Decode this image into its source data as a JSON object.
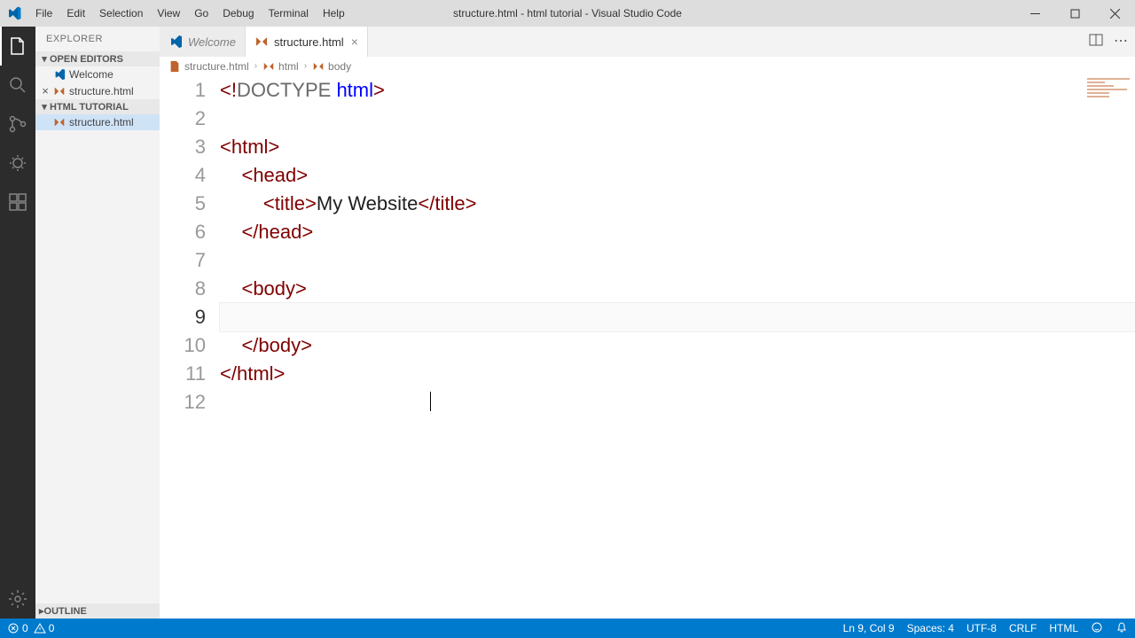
{
  "window": {
    "title": "structure.html - html tutorial - Visual Studio Code"
  },
  "menu": [
    "File",
    "Edit",
    "Selection",
    "View",
    "Go",
    "Debug",
    "Terminal",
    "Help"
  ],
  "sidebar": {
    "title": "Explorer",
    "sections": {
      "open_editors": {
        "label": "Open Editors"
      },
      "project": {
        "label": "HTML Tutorial"
      },
      "outline": {
        "label": "Outline"
      }
    },
    "open_editors": [
      {
        "label": "Welcome",
        "type": "vs"
      },
      {
        "label": "structure.html",
        "type": "html",
        "dirty": false
      }
    ],
    "project_files": [
      {
        "label": "structure.html",
        "type": "html"
      }
    ]
  },
  "tabs": [
    {
      "label": "Welcome",
      "type": "vs",
      "active": false
    },
    {
      "label": "structure.html",
      "type": "html",
      "active": true
    }
  ],
  "breadcrumbs": [
    "structure.html",
    "html",
    "body"
  ],
  "code": {
    "lines": [
      {
        "n": 1,
        "tokens": [
          [
            "p",
            "<!"
          ],
          [
            "doctype",
            "DOCTYPE "
          ],
          [
            "kw",
            "html"
          ],
          [
            "p",
            ">"
          ]
        ]
      },
      {
        "n": 2,
        "tokens": []
      },
      {
        "n": 3,
        "tokens": [
          [
            "p",
            "<"
          ],
          [
            "t",
            "html"
          ],
          [
            "p",
            ">"
          ]
        ]
      },
      {
        "n": 4,
        "indent": 1,
        "tokens": [
          [
            "p",
            "<"
          ],
          [
            "t",
            "head"
          ],
          [
            "p",
            ">"
          ]
        ]
      },
      {
        "n": 5,
        "indent": 2,
        "tokens": [
          [
            "p",
            "<"
          ],
          [
            "t",
            "title"
          ],
          [
            "p",
            ">"
          ],
          [
            "tx",
            "My Website"
          ],
          [
            "p",
            "</"
          ],
          [
            "t",
            "title"
          ],
          [
            "p",
            ">"
          ]
        ]
      },
      {
        "n": 6,
        "indent": 1,
        "tokens": [
          [
            "p",
            "</"
          ],
          [
            "t",
            "head"
          ],
          [
            "p",
            ">"
          ]
        ]
      },
      {
        "n": 7,
        "tokens": []
      },
      {
        "n": 8,
        "indent": 1,
        "tokens": [
          [
            "p",
            "<"
          ],
          [
            "t",
            "body"
          ],
          [
            "p",
            ">"
          ]
        ]
      },
      {
        "n": 9,
        "indent": 2,
        "current": true,
        "tokens": []
      },
      {
        "n": 10,
        "indent": 1,
        "tokens": [
          [
            "p",
            "</"
          ],
          [
            "t",
            "body"
          ],
          [
            "p",
            ">"
          ]
        ]
      },
      {
        "n": 11,
        "tokens": [
          [
            "p",
            "</"
          ],
          [
            "t",
            "html"
          ],
          [
            "p",
            ">"
          ]
        ]
      },
      {
        "n": 12,
        "tokens": []
      }
    ]
  },
  "status": {
    "errors": "0",
    "warnings": "0",
    "ln_col": "Ln 9, Col 9",
    "spaces": "Spaces: 4",
    "encoding": "UTF-8",
    "eol": "CRLF",
    "lang": "HTML"
  }
}
